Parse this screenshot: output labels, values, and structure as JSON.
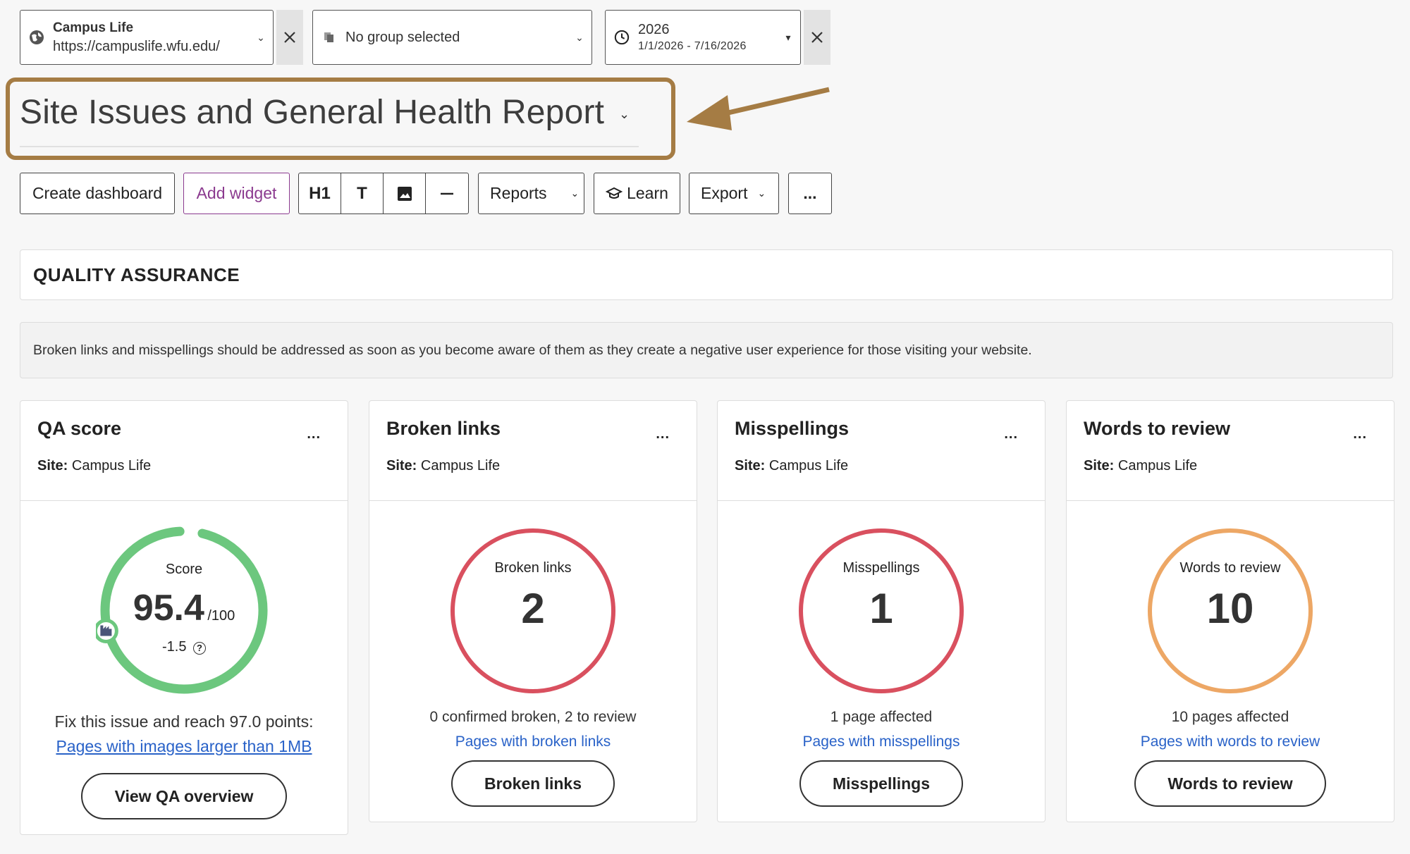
{
  "filters": {
    "site": {
      "name": "Campus Life",
      "url": "https://campuslife.wfu.edu/",
      "icon": "globe-icon"
    },
    "group": {
      "label": "No group selected",
      "icon": "group-icon"
    },
    "date": {
      "year": "2026",
      "range": "1/1/2026 - 7/16/2026",
      "icon": "clock-icon"
    }
  },
  "report": {
    "title": "Site Issues and General Health Report"
  },
  "toolbar": {
    "create_dashboard": "Create dashboard",
    "add_widget": "Add widget",
    "h1": "H1",
    "text_tool": "T",
    "reports": "Reports",
    "learn": "Learn",
    "export": "Export",
    "more": "..."
  },
  "section": {
    "title": "QUALITY ASSURANCE",
    "description": "Broken links and misspellings should be addressed as soon as you become aware of them as they create a negative user experience for those visiting your website."
  },
  "cards": {
    "qa": {
      "title": "QA score",
      "menu": "...",
      "site_label": "Site:",
      "site_value": "Campus Life",
      "ring_label": "Score",
      "score": "95.4",
      "score_max": "/100",
      "change": "-1.5",
      "score_fraction": 0.954,
      "caption": "Fix this issue and reach 97.0 points:",
      "link": "Pages with images larger than 1MB",
      "button": "View QA overview",
      "color": "#6cc77e"
    },
    "broken": {
      "title": "Broken links",
      "menu": "...",
      "site_label": "Site:",
      "site_value": "Campus Life",
      "ring_label": "Broken links",
      "value": "2",
      "caption": "0 confirmed broken, 2 to review",
      "link": "Pages with broken links",
      "button": "Broken links",
      "color": "#d9505f"
    },
    "misspellings": {
      "title": "Misspellings",
      "menu": "...",
      "site_label": "Site:",
      "site_value": "Campus Life",
      "ring_label": "Misspellings",
      "value": "1",
      "caption": "1 page affected",
      "link": "Pages with misspellings",
      "button": "Misspellings",
      "color": "#d9505f"
    },
    "words": {
      "title": "Words to review",
      "menu": "...",
      "site_label": "Site:",
      "site_value": "Campus Life",
      "ring_label": "Words to review",
      "value": "10",
      "caption": "10 pages affected",
      "link": "Pages with words to review",
      "button": "Words to review",
      "color": "#eda765"
    }
  }
}
